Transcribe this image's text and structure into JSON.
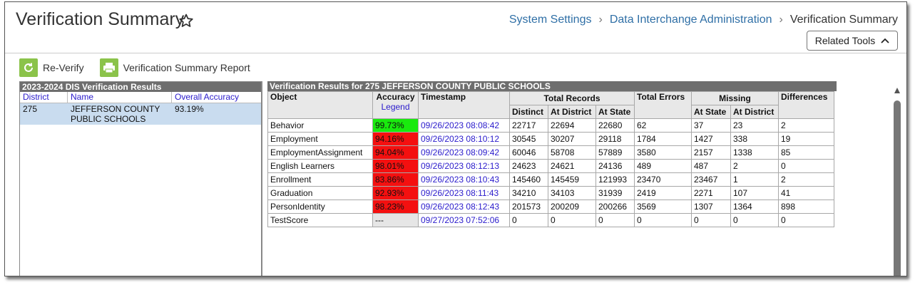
{
  "header": {
    "title": "Verification Summary",
    "breadcrumb": [
      "System Settings",
      "Data Interchange Administration",
      "Verification Summary"
    ],
    "related_tools": "Related Tools"
  },
  "toolbar": {
    "reverify": "Re-Verify",
    "report": "Verification Summary Report"
  },
  "left": {
    "title": "2023-2024 DIS Verification Results",
    "columns": [
      "District",
      "Name",
      "Overall Accuracy"
    ],
    "row": {
      "district": "275",
      "name": "JEFFERSON COUNTY PUBLIC SCHOOLS",
      "accuracy": "93.19%"
    }
  },
  "right": {
    "title": "Verification Results for 275 JEFFERSON COUNTY PUBLIC SCHOOLS",
    "headers": {
      "object": "Object",
      "accuracy": "Accuracy",
      "legend": "Legend",
      "timestamp": "Timestamp",
      "total_records": "Total Records",
      "total_errors": "Total Errors",
      "missing": "Missing",
      "differences": "Differences",
      "distinct": "Distinct",
      "at_district": "At District",
      "at_state": "At State",
      "m_at_state": "At State",
      "m_at_district": "At District"
    },
    "rows": [
      {
        "object": "Behavior",
        "accuracy": "99.73%",
        "status": "green",
        "timestamp": "09/26/2023 08:08:42",
        "distinct": "22717",
        "at_district": "22694",
        "at_state": "22680",
        "errors": "62",
        "m_state": "37",
        "m_district": "23",
        "diff": "2"
      },
      {
        "object": "Employment",
        "accuracy": "94.16%",
        "status": "red",
        "timestamp": "09/26/2023 08:10:12",
        "distinct": "30545",
        "at_district": "30207",
        "at_state": "29118",
        "errors": "1784",
        "m_state": "1427",
        "m_district": "338",
        "diff": "19"
      },
      {
        "object": "EmploymentAssignment",
        "accuracy": "94.04%",
        "status": "red",
        "timestamp": "09/26/2023 08:09:42",
        "distinct": "60046",
        "at_district": "58708",
        "at_state": "57889",
        "errors": "3580",
        "m_state": "2157",
        "m_district": "1338",
        "diff": "85"
      },
      {
        "object": "English Learners",
        "accuracy": "98.01%",
        "status": "red",
        "timestamp": "09/26/2023 08:12:13",
        "distinct": "24623",
        "at_district": "24621",
        "at_state": "24136",
        "errors": "489",
        "m_state": "487",
        "m_district": "2",
        "diff": "0"
      },
      {
        "object": "Enrollment",
        "accuracy": "83.86%",
        "status": "red",
        "timestamp": "09/26/2023 08:10:43",
        "distinct": "145460",
        "at_district": "145459",
        "at_state": "121993",
        "errors": "23470",
        "m_state": "23467",
        "m_district": "1",
        "diff": "2"
      },
      {
        "object": "Graduation",
        "accuracy": "92.93%",
        "status": "red",
        "timestamp": "09/26/2023 08:11:43",
        "distinct": "34210",
        "at_district": "34103",
        "at_state": "31939",
        "errors": "2419",
        "m_state": "2271",
        "m_district": "107",
        "diff": "41"
      },
      {
        "object": "PersonIdentity",
        "accuracy": "98.23%",
        "status": "red",
        "timestamp": "09/26/2023 08:12:43",
        "distinct": "201573",
        "at_district": "200209",
        "at_state": "200266",
        "errors": "3569",
        "m_state": "1307",
        "m_district": "1364",
        "diff": "898"
      },
      {
        "object": "TestScore",
        "accuracy": "---",
        "status": "gray",
        "timestamp": "09/27/2023 07:52:06",
        "distinct": "0",
        "at_district": "0",
        "at_state": "0",
        "errors": "0",
        "m_state": "0",
        "m_district": "0",
        "diff": "0"
      }
    ]
  },
  "colors": {
    "green": "#19ea0e",
    "red": "#f41010",
    "gray": "#e6e6e6",
    "link": "#2a1bcc",
    "accent": "#8bc34a"
  }
}
